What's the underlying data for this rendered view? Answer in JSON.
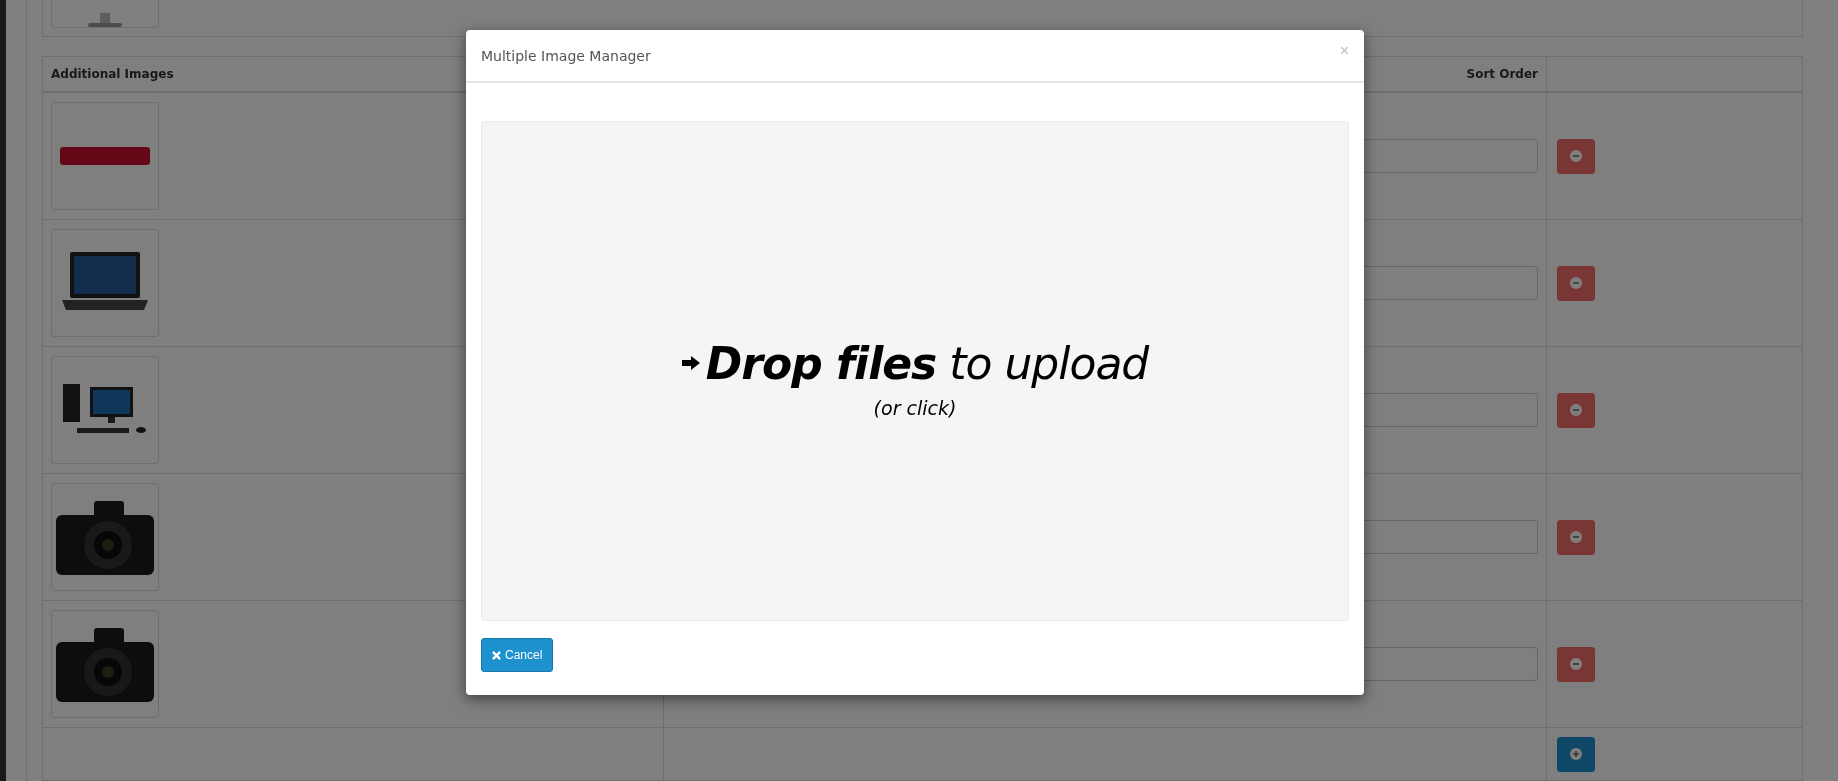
{
  "table": {
    "columns": [
      "Additional Images",
      "Sort Order"
    ],
    "rows": [
      {
        "kind": "logo"
      },
      {
        "kind": "laptop"
      },
      {
        "kind": "desktop"
      },
      {
        "kind": "camera"
      },
      {
        "kind": "camera"
      }
    ]
  },
  "modal": {
    "title": "Multiple Image Manager",
    "close": "×",
    "dropzone": {
      "headline": "**Drop files** to upload",
      "hint": "(or click)"
    },
    "buttons": [
      {
        "label": "Cancel",
        "kind": "cancel"
      }
    ]
  }
}
